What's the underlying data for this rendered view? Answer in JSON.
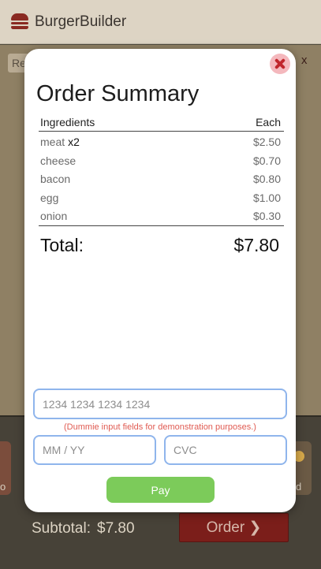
{
  "app": {
    "title": "BurgerBuilder",
    "reset_label": "Re",
    "close_label": "x",
    "ingredient_left_label": "o",
    "ingredient_right_label": "d",
    "subtotal_label": "Subtotal:",
    "subtotal_value": "$7.80",
    "order_label": "Order ❯"
  },
  "modal": {
    "title": "Order Summary",
    "close_icon": "close-icon",
    "table": {
      "headers": [
        "Ingredients",
        "Each"
      ],
      "rows": [
        {
          "name": "meat",
          "qty": "x2",
          "price": "$2.50"
        },
        {
          "name": "cheese",
          "qty": "",
          "price": "$0.70"
        },
        {
          "name": "bacon",
          "qty": "",
          "price": "$0.80"
        },
        {
          "name": "egg",
          "qty": "",
          "price": "$1.00"
        },
        {
          "name": "onion",
          "qty": "",
          "price": "$0.30"
        }
      ]
    },
    "total_label": "Total:",
    "total_value": "$7.80",
    "payment": {
      "card_placeholder": "1234 1234 1234 1234",
      "disclaimer": "(Dummie input fields for demonstration purposes.)",
      "expiry_placeholder": "MM / YY",
      "cvc_placeholder": "CVC",
      "pay_label": "Pay"
    }
  },
  "colors": {
    "brand": "#8a2a22",
    "pay_button": "#7ccb5a",
    "input_border": "#8fb5ec",
    "disclaimer": "#e05b52",
    "close_accent": "#c1272d"
  }
}
